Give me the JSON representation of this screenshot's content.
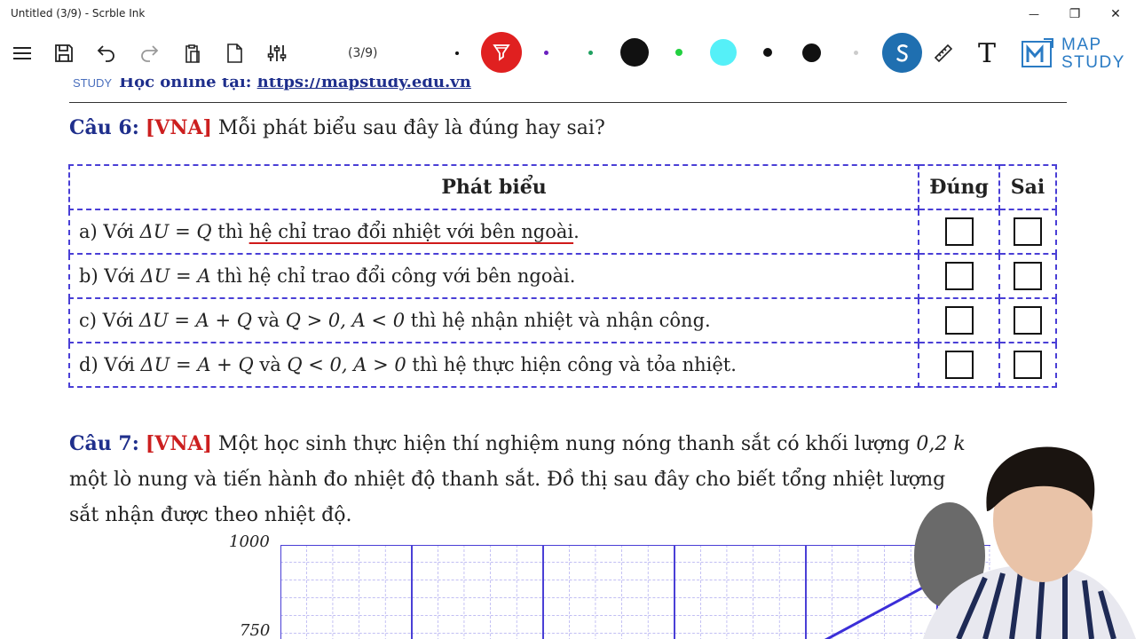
{
  "window": {
    "title": "Untitled (3/9) - Scrble Ink",
    "minimize": "—",
    "restore": "❐",
    "close": "✕"
  },
  "toolbar": {
    "page_indicator": "(3/9)",
    "icons": [
      "menu-icon",
      "save-icon",
      "undo-icon",
      "redo-icon",
      "clipboard-icon",
      "new-page-icon",
      "settings-sliders-icon",
      "highlighter-icon",
      "ruler-icon",
      "text-tool-icon"
    ],
    "colors": {
      "active_tool_bg": "#e02020",
      "purple_dot": "#6a1fbf",
      "green_dot": "#1fa060",
      "black": "#111111",
      "lime": "#22d040",
      "cyan": "#55f0f8",
      "gray_dot": "#cccccc",
      "stylus_bg": "#1f6fb0"
    },
    "text_tool": "T"
  },
  "logo": {
    "line1": "MAP",
    "line2": "STUDY"
  },
  "document": {
    "header": {
      "logo_text": "STUDY",
      "label": "Học online tại: ",
      "url": "https://mapstudy.edu.vn"
    },
    "q6": {
      "label": "Câu 6:",
      "tag": "[VNA]",
      "text": " Mỗi phát biểu sau đây là đúng hay sai?"
    },
    "table": {
      "headers": [
        "Phát biểu",
        "Đúng",
        "Sai"
      ],
      "rows": [
        {
          "prefix": "a) Với ",
          "math": "ΔU = Q",
          "mid": " thì ",
          "underlined": "hệ chỉ trao đổi nhiệt với bên ngoài",
          "end": "."
        },
        {
          "prefix": "b) Với ",
          "math": "ΔU = A",
          "mid": " thì hệ chỉ trao đổi công với bên ngoài.",
          "underlined": "",
          "end": ""
        },
        {
          "prefix": "c) Với ",
          "math": "ΔU = A + Q",
          "mid": " và ",
          "cond": "Q > 0, A < 0",
          "rest": " thì hệ nhận nhiệt và nhận công."
        },
        {
          "prefix": "d) Với ",
          "math": "ΔU = A + Q",
          "mid": " và ",
          "cond": "Q < 0, A > 0",
          "rest": " thì hệ thực hiện công và tỏa nhiệt."
        }
      ]
    },
    "q7": {
      "label": "Câu 7:",
      "tag": "[VNA]",
      "line1": " Một học sinh thực hiện thí nghiệm nung nóng thanh sắt có khối lượng ",
      "line1_math": "0,2 k",
      "line2": "một lò nung và tiến hành đo nhiệt độ thanh sắt. Đồ thị sau đây cho biết tổng nhiệt lượng",
      "line3": "sắt nhận được theo nhiệt độ."
    },
    "chart": {
      "y_ticks": [
        "1000",
        "750"
      ]
    }
  }
}
